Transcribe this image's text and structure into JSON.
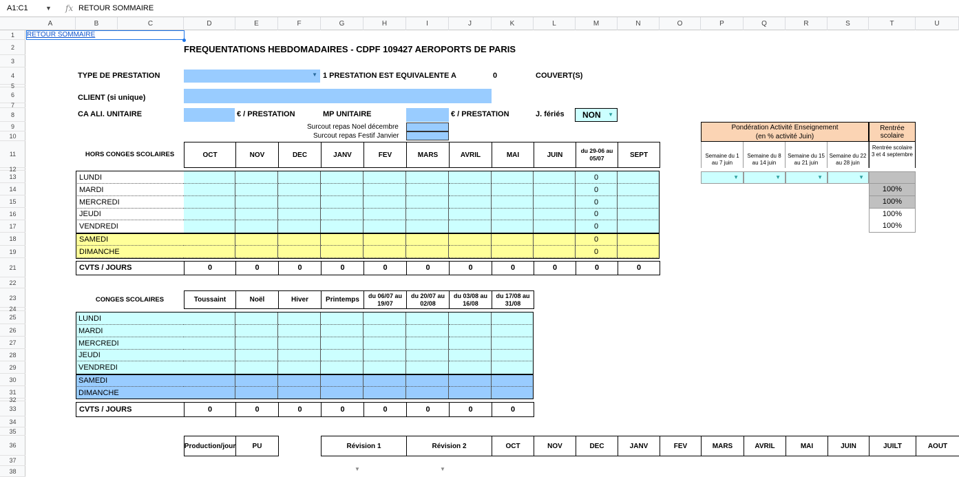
{
  "formula_bar": {
    "cell_ref": "A1:C1",
    "fx": "fx",
    "content": "RETOUR SOMMAIRE"
  },
  "columns": [
    "A",
    "B",
    "C",
    "D",
    "E",
    "F",
    "G",
    "H",
    "I",
    "J",
    "K",
    "L",
    "M",
    "N",
    "O",
    "P",
    "Q",
    "R",
    "S",
    "T",
    "U"
  ],
  "rows": [
    "1",
    "2",
    "3",
    "4",
    "5",
    "6",
    "7",
    "8",
    "9",
    "10",
    "11",
    "12",
    "13",
    "14",
    "15",
    "16",
    "17",
    "18",
    "19",
    "21",
    "22",
    "23",
    "24",
    "25",
    "26",
    "27",
    "28",
    "29",
    "30",
    "31",
    "32",
    "33",
    "34",
    "35",
    "36",
    "37",
    "38"
  ],
  "link": "RETOUR SOMMAIRE",
  "title": "FREQUENTATIONS HEBDOMADAIRES - CDPF 109427 AEROPORTS DE PARIS",
  "top": {
    "type_prestation": "TYPE DE PRESTATION",
    "equivalente": "1 PRESTATION EST EQUIVALENTE A",
    "equivalente_value": "0",
    "couverts": "COUVERT(S)",
    "client": "CLIENT (si unique)",
    "ca_unitaire": "CA ALI. UNITAIRE",
    "per_prestation_1": "€ / PRESTATION",
    "mp_unitaire": "MP UNITAIRE",
    "per_prestation_2": "€ / PRESTATION",
    "jferies": "J. fériés",
    "jferies_value": "NON",
    "surcout_noel": "Surcout repas Noel décembre",
    "surcout_festif": "Surcout repas Festif Janvier"
  },
  "hors": {
    "header": "HORS CONGES SCOLAIRES",
    "months": [
      "OCT",
      "NOV",
      "DEC",
      "JANV",
      "FEV",
      "MARS",
      "AVRIL",
      "MAI",
      "JUIN",
      "du 29-06 au 05/07",
      "SEPT"
    ],
    "days": [
      "LUNDI",
      "MARDI",
      "MERCREDI",
      "JEUDI",
      "VENDREDI",
      "SAMEDI",
      "DIMANCHE"
    ],
    "m_values": [
      "0",
      "0",
      "0",
      "0",
      "0",
      "0",
      "0"
    ],
    "total_label": "CVTS / JOURS",
    "totals": [
      "0",
      "0",
      "0",
      "0",
      "0",
      "0",
      "0",
      "0",
      "0",
      "0",
      "0"
    ]
  },
  "conges": {
    "header": "CONGES SCOLAIRES",
    "periods": [
      "Toussaint",
      "Noël",
      "Hiver",
      "Printemps",
      "du 06/07 au 19/07",
      "du 20/07 au 02/08",
      "du 03/08 au 16/08",
      "du 17/08 au 31/08"
    ],
    "days": [
      "LUNDI",
      "MARDI",
      "MERCREDI",
      "JEUDI",
      "VENDREDI",
      "SAMEDI",
      "DIMANCHE"
    ],
    "total_label": "CVTS / JOURS",
    "totals": [
      "0",
      "0",
      "0",
      "0",
      "0",
      "0",
      "0",
      "0"
    ]
  },
  "ponderation": {
    "title": "Pondération Activité Enseignement",
    "subtitle": "(en % activité Juin)",
    "rentree": "Rentrée scolaire",
    "weeks": [
      "Semaine du 1 au 7 juin",
      "Semaine du 8 au 14 juin",
      "Semaine du 15 au 21 juin",
      "Semaine du 22 au 28 juin"
    ],
    "rentree_detail": "Rentrée scolaire 3 et 4 septembre",
    "percents": [
      "100%",
      "100%",
      "100%",
      "100%"
    ]
  },
  "bottom": {
    "headers": [
      "Production/jour",
      "PU",
      "Révision 1",
      "Révision 2",
      "OCT",
      "NOV",
      "DEC",
      "JANV",
      "FEV",
      "MARS",
      "AVRIL",
      "MAI",
      "JUIN",
      "JUILT",
      "AOUT"
    ]
  },
  "colors": {
    "input_blue": "#99ccff",
    "cyan": "#ccffff",
    "yellow": "#ffff99",
    "peach": "#fbd4b4",
    "grey": "#c0c0c0",
    "link": "#1155cc"
  }
}
